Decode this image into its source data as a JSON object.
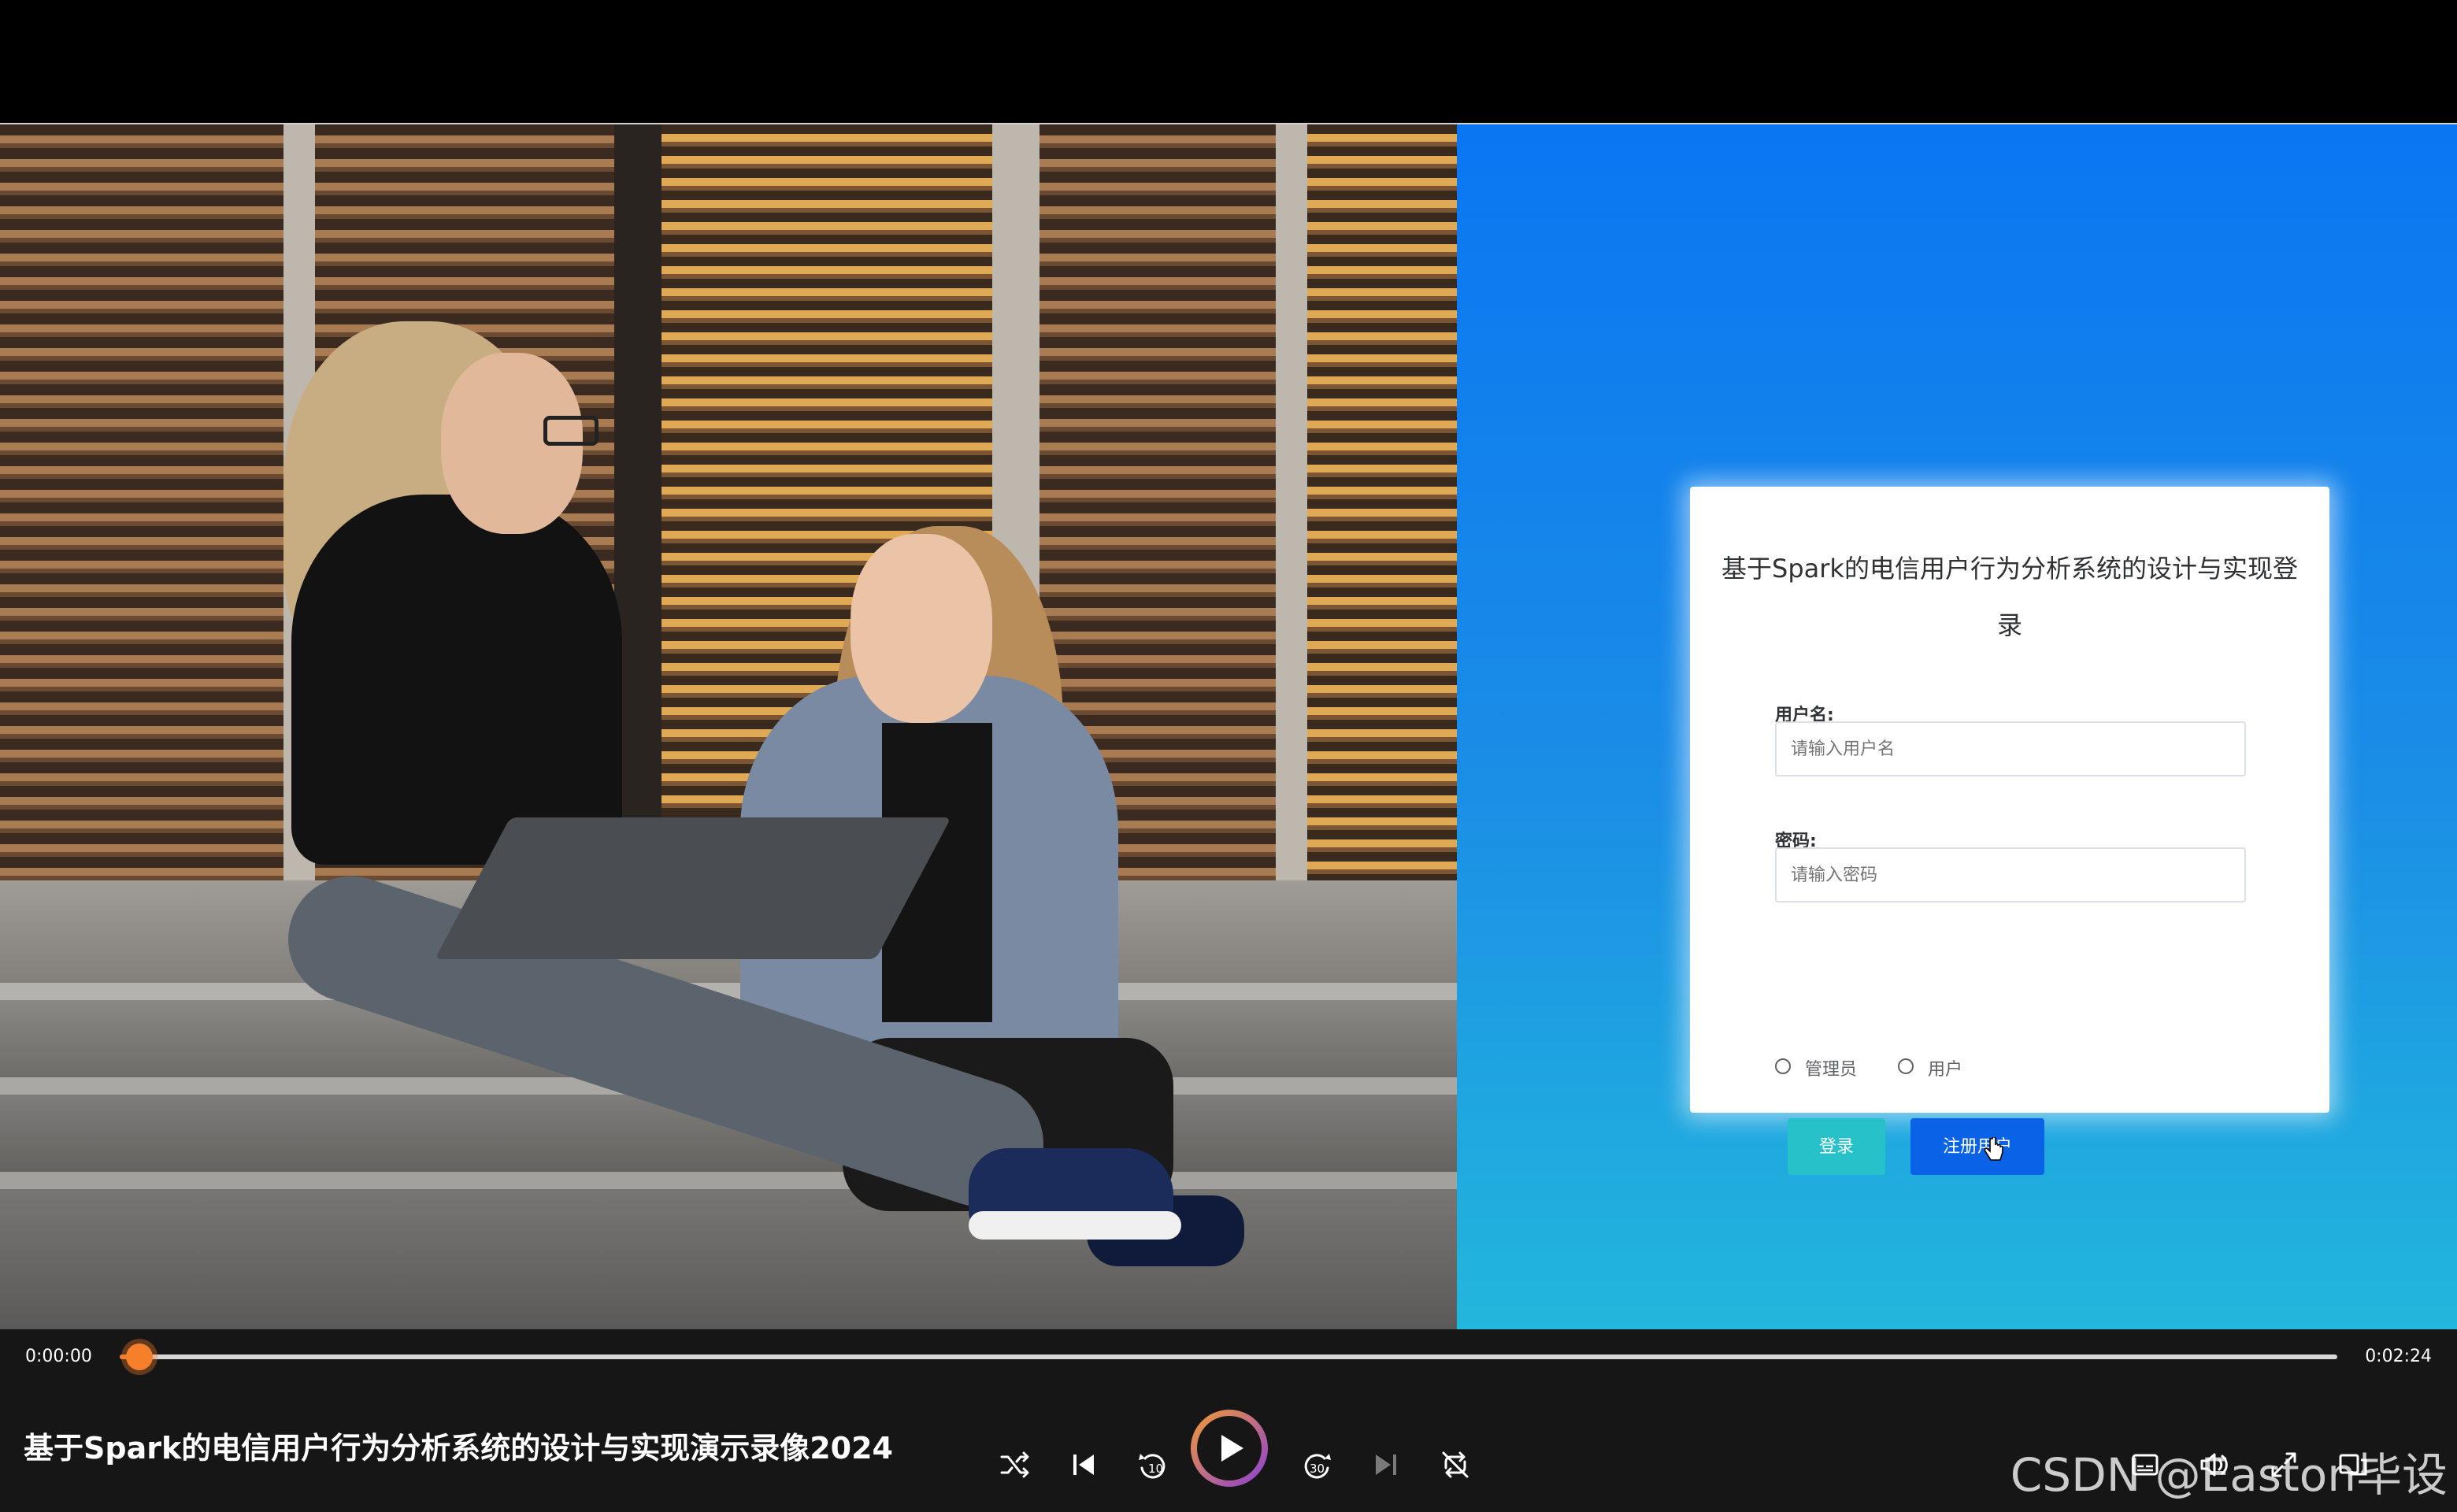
{
  "login": {
    "title": "基于Spark的电信用户行为分析系统的设计与实现登录",
    "username_label": "用户名:",
    "username_placeholder": "请输入用户名",
    "password_label": "密码:",
    "password_placeholder": "请输入密码",
    "role_options": [
      "管理员",
      "用户"
    ],
    "login_button": "登录",
    "register_button": "注册用户"
  },
  "player": {
    "time_current": "0:00:00",
    "time_total": "0:02:24",
    "progress": 0.009,
    "title": "基于Spark的电信用户行为分析系统的设计与实现演示录像2024",
    "icons": [
      "shuffle-icon",
      "previous-icon",
      "rewind-10-icon",
      "play-icon",
      "forward-30-icon",
      "next-icon",
      "repeat-off-icon",
      "subtitles-icon",
      "volume-icon",
      "fullscreen-icon",
      "mini-player-icon"
    ]
  },
  "watermark": "CSDN @Easton毕设",
  "colors": {
    "accent_progress": "#f57f2a",
    "login_button": "#27c1ca",
    "register_button": "#0a62e6",
    "login_background": "#0a76f2"
  }
}
